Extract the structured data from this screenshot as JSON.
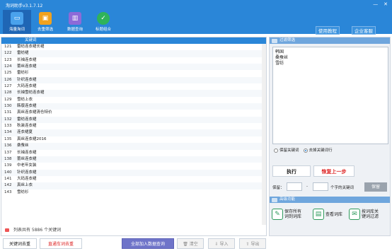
{
  "app": {
    "title": "淘词助手v3.1.7.12"
  },
  "window_buttons": [
    "—",
    "✕"
  ],
  "toolbar": [
    {
      "label": "海量淘词",
      "icon": "chat-icon",
      "color": "#4aa2ec",
      "glyph": "▭"
    },
    {
      "label": "去重筛选",
      "icon": "box-icon",
      "color": "#f0a21f",
      "glyph": "▣"
    },
    {
      "label": "数据查询",
      "icon": "bar-chart-icon",
      "color": "#8d6ad8",
      "glyph": "▥"
    },
    {
      "label": "标题组合",
      "icon": "check-circle-icon",
      "color": "#2fb35a",
      "glyph": "✓"
    }
  ],
  "help": {
    "tutorial": "使用教程",
    "service": "企业客服"
  },
  "list": {
    "header": "关键词",
    "rows": [
      {
        "num": "121",
        "kw": "雷纺连衣裙长裙"
      },
      {
        "num": "122",
        "kw": "雷纺裙"
      },
      {
        "num": "123",
        "kw": "长袖连衣裙"
      },
      {
        "num": "124",
        "kw": "蕾丝连衣裙"
      },
      {
        "num": "125",
        "kw": "雷纺衫"
      },
      {
        "num": "126",
        "kw": "针织连衣裙"
      },
      {
        "num": "127",
        "kw": "大码连衣裙"
      },
      {
        "num": "128",
        "kw": "长袖雪纺连衣裙"
      },
      {
        "num": "129",
        "kw": "雪纺上衣"
      },
      {
        "num": "130",
        "kw": "韩版连衣裙"
      },
      {
        "num": "131",
        "kw": "真丝连衣裙清仓特价"
      },
      {
        "num": "132",
        "kw": "雷纺连衣裙"
      },
      {
        "num": "133",
        "kw": "秋装连衣裙"
      },
      {
        "num": "134",
        "kw": "连衣裙夏"
      },
      {
        "num": "135",
        "kw": "真丝连衣裙2016"
      },
      {
        "num": "136",
        "kw": "桑蚕丝"
      },
      {
        "num": "137",
        "kw": "长袖连衣裙"
      },
      {
        "num": "138",
        "kw": "蕾丝连衣裙"
      },
      {
        "num": "139",
        "kw": "中老年女装"
      },
      {
        "num": "140",
        "kw": "针织连衣裙"
      },
      {
        "num": "141",
        "kw": "大码连衣裙"
      },
      {
        "num": "142",
        "kw": "真丝上衣"
      },
      {
        "num": "143",
        "kw": "雪纺衫"
      }
    ],
    "status": "列表共有 5886 个关键词"
  },
  "bottom": {
    "keyword_dedupe": "关键词去重",
    "through_train_dedupe": "直通车词去重",
    "add_all_query": "全部加入数据查询",
    "clear": "清空",
    "import": "导入",
    "export": "导出"
  },
  "filter": {
    "header": "过滤筛选",
    "text_lines": [
      "韩国",
      "桑蚕丝",
      "雪纺"
    ],
    "radio_keep": "保留关键词",
    "radio_remove": "去掉关键词行",
    "execute": "执行",
    "restore": "恢复上一步",
    "keep_label": "保留：",
    "keep_dash": "-",
    "keep_suffix": "个字的关键词",
    "keep_button": "保留"
  },
  "advanced": {
    "header": "高级功能",
    "save_all": [
      "保存所有",
      "词到词库"
    ],
    "view_lib": "查看词库",
    "filter_by_lib": [
      "按词库关",
      "键词过滤"
    ]
  }
}
